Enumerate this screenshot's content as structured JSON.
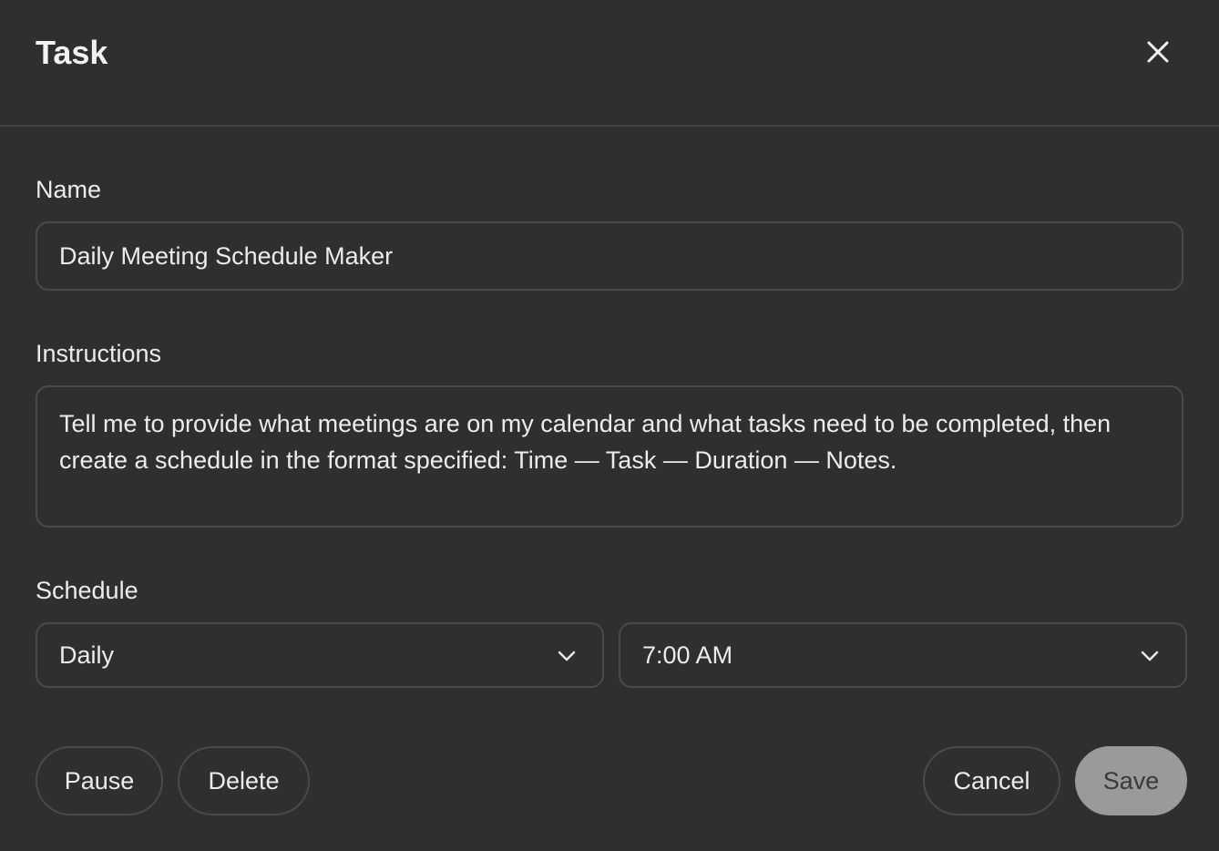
{
  "dialog": {
    "title": "Task"
  },
  "name": {
    "label": "Name",
    "value": "Daily Meeting Schedule Maker"
  },
  "instructions": {
    "label": "Instructions",
    "value": "Tell me to provide what meetings are on my calendar and what tasks need to be completed, then create a schedule in the format specified: Time — Task — Duration — Notes."
  },
  "schedule": {
    "label": "Schedule",
    "frequency": "Daily",
    "time": "7:00 AM"
  },
  "buttons": {
    "pause": "Pause",
    "delete": "Delete",
    "cancel": "Cancel",
    "save": "Save"
  },
  "icons": {
    "close": "close-icon",
    "chevron": "chevron-down-icon"
  },
  "colors": {
    "background": "#2f2f2f",
    "border": "#4a4a4a",
    "text": "#ececec",
    "save_disabled_bg": "#9a9a9a",
    "save_disabled_text": "#3a3a3a"
  }
}
